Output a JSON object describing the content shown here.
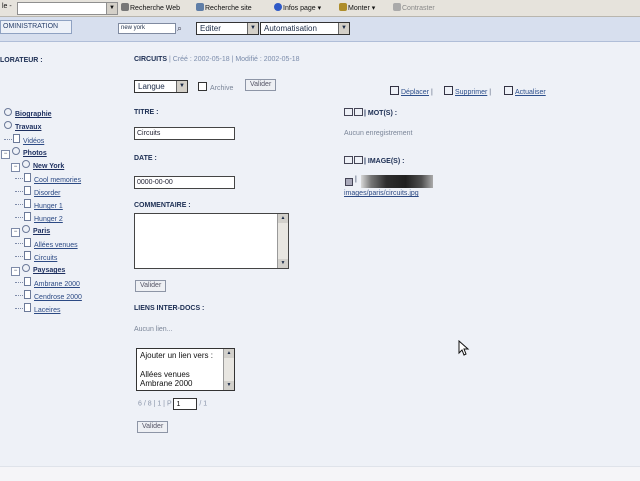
{
  "toolbar": {
    "url_fragment": "le -",
    "web_search": "Recherche Web",
    "site_search": "Recherche site",
    "page_info": "Infos page",
    "up": "Monter",
    "highlight": "Contraster"
  },
  "admin": {
    "tab_label": "OMINISTRATION",
    "search_value": "new york",
    "edit_select": "Editer",
    "automation_select": "Automatisation"
  },
  "explorer": {
    "title": "LORATEUR :"
  },
  "tree": {
    "items": [
      {
        "label": "Biographie",
        "level": 0,
        "type": "folder",
        "bold": true
      },
      {
        "label": "Travaux",
        "level": 0,
        "type": "folder",
        "bold": true
      },
      {
        "label": "Vidéos",
        "level": 1,
        "type": "doc"
      },
      {
        "label": "Photos",
        "level": 0,
        "type": "folder",
        "bold": true,
        "expanded": true
      },
      {
        "label": "New York",
        "level": 1,
        "type": "folder",
        "bold": true,
        "expanded": true
      },
      {
        "label": "Cool memories",
        "level": 2,
        "type": "doc"
      },
      {
        "label": "Disorder",
        "level": 2,
        "type": "doc"
      },
      {
        "label": "Hunger 1",
        "level": 2,
        "type": "doc"
      },
      {
        "label": "Hunger 2",
        "level": 2,
        "type": "doc"
      },
      {
        "label": "Paris",
        "level": 1,
        "type": "folder",
        "bold": true,
        "expanded": true
      },
      {
        "label": "Allées venues",
        "level": 2,
        "type": "doc"
      },
      {
        "label": "Circuits",
        "level": 2,
        "type": "doc"
      },
      {
        "label": "Paysages",
        "level": 1,
        "type": "folder",
        "bold": true,
        "expanded": true
      },
      {
        "label": "Ambrane 2000",
        "level": 2,
        "type": "doc"
      },
      {
        "label": "Cendrose 2000",
        "level": 2,
        "type": "doc"
      },
      {
        "label": "Laceires",
        "level": 2,
        "type": "doc"
      }
    ]
  },
  "doc": {
    "title": "CIRCUITS",
    "created_label": "Créé :",
    "created_value": "2002-05-18",
    "modified_label": "Modifié :",
    "modified_value": "2002-05-18",
    "language_select": "Langue",
    "archive_label": "Archive",
    "validate_top": "Valider",
    "move_link": "Déplacer",
    "delete_link": "Supprimer",
    "refresh_link": "Actualiser",
    "title_label": "TITRE :",
    "title_value": "Circuits",
    "date_label": "DATE :",
    "date_value": "0000-00-00",
    "comment_label": "COMMENTAIRE :",
    "validate_comment": "Valider",
    "links_label": "LIENS INTER-DOCS :",
    "no_link": "Aucun lien...",
    "link_options": [
      "Ajouter un lien vers :",
      "",
      "Allées venues",
      "Ambrane 2000"
    ],
    "pager_left": "6 / 8",
    "pager_mid": "| 1 |",
    "pager_p": "P",
    "pager_value": "1",
    "pager_total": "/ 1",
    "validate_bottom": "Valider"
  },
  "right": {
    "keywords_heading": "MOT(S) :",
    "keywords_empty": "Aucun enregistrement",
    "images_heading": "IMAGE(S) :",
    "image_path": "images/paris/circuits.jpg"
  }
}
